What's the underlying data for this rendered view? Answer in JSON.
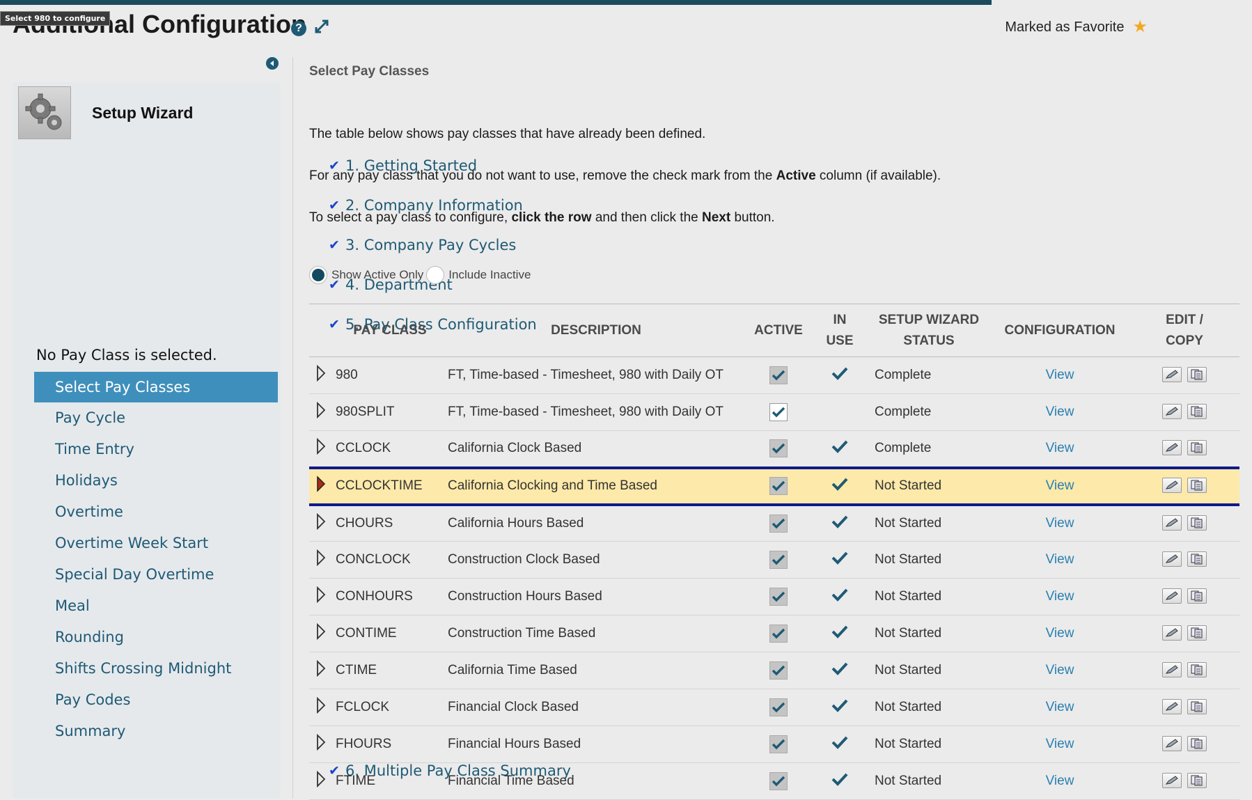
{
  "header": {
    "title": "Additional Configuration",
    "tooltip": "Select 980 to configure",
    "favorite_label": "Marked as Favorite"
  },
  "sidebar": {
    "wizard_title": "Setup Wizard",
    "steps": [
      {
        "label": "1. Getting Started"
      },
      {
        "label": "2. Company Information"
      },
      {
        "label": "3. Company Pay Cycles"
      },
      {
        "label": "4. Department"
      },
      {
        "label": "5. Pay Class Configuration"
      },
      {
        "label": "6. Multiple Pay Class Summary"
      }
    ],
    "info": "No Pay Class is selected.",
    "substeps": [
      {
        "label": "Select Pay Classes"
      },
      {
        "label": "Pay Cycle"
      },
      {
        "label": "Time Entry"
      },
      {
        "label": "Holidays"
      },
      {
        "label": "Overtime"
      },
      {
        "label": "Overtime Week Start"
      },
      {
        "label": "Special Day Overtime"
      },
      {
        "label": "Meal"
      },
      {
        "label": "Rounding"
      },
      {
        "label": "Shifts Crossing Midnight"
      },
      {
        "label": "Pay Codes"
      },
      {
        "label": "Summary"
      }
    ]
  },
  "main": {
    "section_title": "Select Pay Classes",
    "para1": "The table below shows pay classes that have already been defined.",
    "para2": {
      "before": "For any pay class that you do not want to use, remove the check mark from the ",
      "bold": "Active",
      "after": " column (if available)."
    },
    "para3": {
      "before": "To select a pay class to configure, ",
      "bold1": "click the row",
      "middle": " and then click the ",
      "bold2": "Next",
      "after": " button."
    },
    "filter": {
      "show_active_only": "Show Active Only",
      "include_inactive": "Include Inactive",
      "selected": "Show Active Only"
    }
  },
  "table": {
    "headers": {
      "pay_class": "PAY CLASS",
      "description": "DESCRIPTION",
      "active": "ACTIVE",
      "in_use_1": "IN",
      "in_use_2": "USE",
      "status_1": "SETUP WIZARD",
      "status_2": "STATUS",
      "configuration": "CONFIGURATION",
      "editcopy_1": "EDIT /",
      "editcopy_2": "COPY"
    },
    "view_label": "View",
    "rows": [
      {
        "code": "980",
        "description": "FT, Time-based - Timesheet, 980 with Daily OT",
        "active": true,
        "active_editable": false,
        "in_use": true,
        "status": "Complete",
        "selected": false
      },
      {
        "code": "980SPLIT",
        "description": "FT, Time-based - Timesheet, 980 with Daily OT",
        "active": true,
        "active_editable": true,
        "in_use": false,
        "status": "Complete",
        "selected": false
      },
      {
        "code": "CCLOCK",
        "description": "California Clock Based",
        "active": true,
        "active_editable": false,
        "in_use": true,
        "status": "Complete",
        "selected": false
      },
      {
        "code": "CCLOCKTIME",
        "description": "California Clocking and Time Based",
        "active": true,
        "active_editable": false,
        "in_use": true,
        "status": "Not Started",
        "selected": true
      },
      {
        "code": "CHOURS",
        "description": "California Hours Based",
        "active": true,
        "active_editable": false,
        "in_use": true,
        "status": "Not Started",
        "selected": false
      },
      {
        "code": "CONCLOCK",
        "description": "Construction Clock Based",
        "active": true,
        "active_editable": false,
        "in_use": true,
        "status": "Not Started",
        "selected": false
      },
      {
        "code": "CONHOURS",
        "description": "Construction Hours Based",
        "active": true,
        "active_editable": false,
        "in_use": true,
        "status": "Not Started",
        "selected": false
      },
      {
        "code": "CONTIME",
        "description": "Construction Time Based",
        "active": true,
        "active_editable": false,
        "in_use": true,
        "status": "Not Started",
        "selected": false
      },
      {
        "code": "CTIME",
        "description": "California Time Based",
        "active": true,
        "active_editable": false,
        "in_use": true,
        "status": "Not Started",
        "selected": false
      },
      {
        "code": "FCLOCK",
        "description": "Financial Clock Based",
        "active": true,
        "active_editable": false,
        "in_use": true,
        "status": "Not Started",
        "selected": false
      },
      {
        "code": "FHOURS",
        "description": "Financial Hours Based",
        "active": true,
        "active_editable": false,
        "in_use": true,
        "status": "Not Started",
        "selected": false
      },
      {
        "code": "FTIME",
        "description": "Financial Time Based",
        "active": true,
        "active_editable": false,
        "in_use": true,
        "status": "Not Started",
        "selected": false
      }
    ]
  },
  "colors": {
    "accent": "#1e5a75",
    "active_nav": "#3f8fbc",
    "selected_row": "#fde9a9",
    "selected_border": "#0e1a8c",
    "link": "#2a7fb0",
    "star": "#f2a81d"
  },
  "icons": {
    "help": "question-circle-icon",
    "expand": "expand-arrows-icon",
    "favorite": "star-icon",
    "collapse": "collapse-left-icon",
    "wizard": "gear-icon",
    "row_expander": "triangle-right-icon",
    "edit": "pencil-icon",
    "copy": "copy-icon"
  }
}
